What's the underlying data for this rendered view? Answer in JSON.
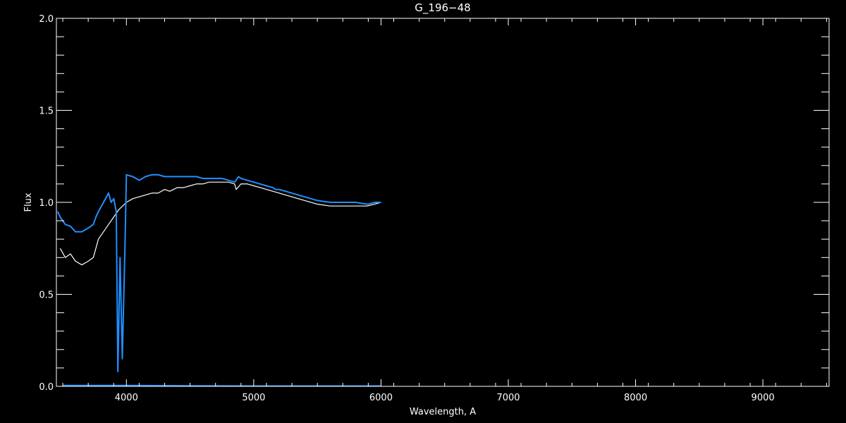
{
  "chart_data": {
    "type": "line",
    "title": "G_196−48",
    "xlabel": "Wavelength, A",
    "ylabel": "Flux",
    "xlim": [
      3450,
      9520
    ],
    "ylim": [
      0.0,
      2.0
    ],
    "x_ticks": [
      4000,
      5000,
      6000,
      7000,
      8000,
      9000
    ],
    "x_tick_labels": [
      "4000",
      "5000",
      "6000",
      "7000",
      "8000",
      "9000"
    ],
    "y_ticks": [
      0.0,
      0.5,
      1.0,
      1.5,
      2.0
    ],
    "y_tick_labels": [
      "0.0",
      "0.5",
      "1.0",
      "1.5",
      "2.0"
    ],
    "grid": false,
    "series": [
      {
        "color": "#ffffff",
        "x": [
          3480,
          3520,
          3560,
          3600,
          3650,
          3700,
          3740,
          3780,
          3820,
          3860,
          3900,
          3940,
          3970,
          4000,
          4050,
          4100,
          4150,
          4200,
          4250,
          4300,
          4340,
          4400,
          4450,
          4500,
          4550,
          4600,
          4650,
          4700,
          4750,
          4800,
          4850,
          4862,
          4900,
          4950,
          5000,
          5050,
          5100,
          5150,
          5200,
          5250,
          5300,
          5400,
          5500,
          5600,
          5700,
          5800,
          5890,
          5950,
          6000
        ],
        "y": [
          0.75,
          0.7,
          0.72,
          0.68,
          0.66,
          0.68,
          0.7,
          0.8,
          0.84,
          0.88,
          0.92,
          0.96,
          0.98,
          1.0,
          1.02,
          1.03,
          1.04,
          1.05,
          1.05,
          1.07,
          1.06,
          1.08,
          1.08,
          1.09,
          1.1,
          1.1,
          1.11,
          1.11,
          1.11,
          1.11,
          1.1,
          1.07,
          1.1,
          1.1,
          1.09,
          1.08,
          1.07,
          1.06,
          1.05,
          1.04,
          1.03,
          1.01,
          0.99,
          0.98,
          0.98,
          0.98,
          0.98,
          0.99,
          1.0
        ]
      },
      {
        "color": "#1f8fff",
        "x": [
          3460,
          3480,
          3520,
          3560,
          3600,
          3650,
          3700,
          3740,
          3760,
          3780,
          3820,
          3860,
          3880,
          3900,
          3920,
          3933,
          3950,
          3968,
          3990,
          4000,
          4050,
          4101,
          4150,
          4200,
          4250,
          4300,
          4340,
          4360,
          4400,
          4450,
          4500,
          4550,
          4600,
          4650,
          4700,
          4750,
          4800,
          4850,
          4861,
          4880,
          4900,
          4950,
          5000,
          5050,
          5100,
          5150,
          5170,
          5200,
          5250,
          5300,
          5400,
          5500,
          5600,
          5700,
          5800,
          5890,
          5900,
          5950,
          6000
        ],
        "y": [
          0.95,
          0.92,
          0.88,
          0.87,
          0.84,
          0.84,
          0.86,
          0.88,
          0.92,
          0.95,
          1.0,
          1.05,
          1.0,
          1.02,
          0.95,
          0.08,
          0.7,
          0.15,
          0.8,
          1.15,
          1.14,
          1.12,
          1.14,
          1.15,
          1.15,
          1.14,
          1.14,
          1.14,
          1.14,
          1.14,
          1.14,
          1.14,
          1.13,
          1.13,
          1.13,
          1.13,
          1.12,
          1.11,
          1.12,
          1.14,
          1.13,
          1.12,
          1.11,
          1.1,
          1.09,
          1.08,
          1.07,
          1.07,
          1.06,
          1.05,
          1.03,
          1.01,
          1.0,
          1.0,
          1.0,
          0.99,
          0.99,
          1.0,
          1.0
        ]
      },
      {
        "color": "#1f8fff",
        "x": [
          3500,
          4000,
          4500,
          5000,
          5500,
          6000
        ],
        "y": [
          0.005,
          0.005,
          0.003,
          0.002,
          0.002,
          0.002
        ]
      }
    ]
  }
}
